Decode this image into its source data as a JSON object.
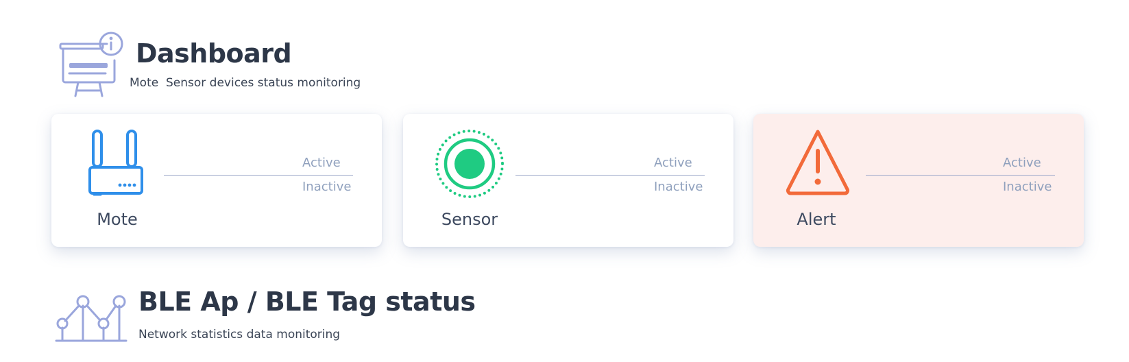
{
  "dashboard": {
    "title": "Dashboard",
    "subtitle": "Mote  Sensor devices status monitoring",
    "icon": "presentation-board-info-icon"
  },
  "cards": [
    {
      "name": "Mote",
      "icon": "router-icon",
      "active_label": "Active",
      "inactive_label": "Inactive",
      "accent": "#2f8fea"
    },
    {
      "name": "Sensor",
      "icon": "sensor-signal-icon",
      "active_label": "Active",
      "inactive_label": "Inactive",
      "accent": "#1fcb82"
    },
    {
      "name": "Alert",
      "icon": "warning-triangle-icon",
      "active_label": "Active",
      "inactive_label": "Inactive",
      "accent": "#f26a3a",
      "background": "#fdeeec"
    }
  ],
  "ble": {
    "title": "BLE Ap / BLE Tag status",
    "subtitle": "Network statistics data monitoring",
    "icon": "network-chart-icon"
  },
  "colors": {
    "icon_header": "#9aa6dc",
    "title_text": "#2d3748",
    "stat_text": "#8fa0bd",
    "divider": "#9aa6c8"
  }
}
